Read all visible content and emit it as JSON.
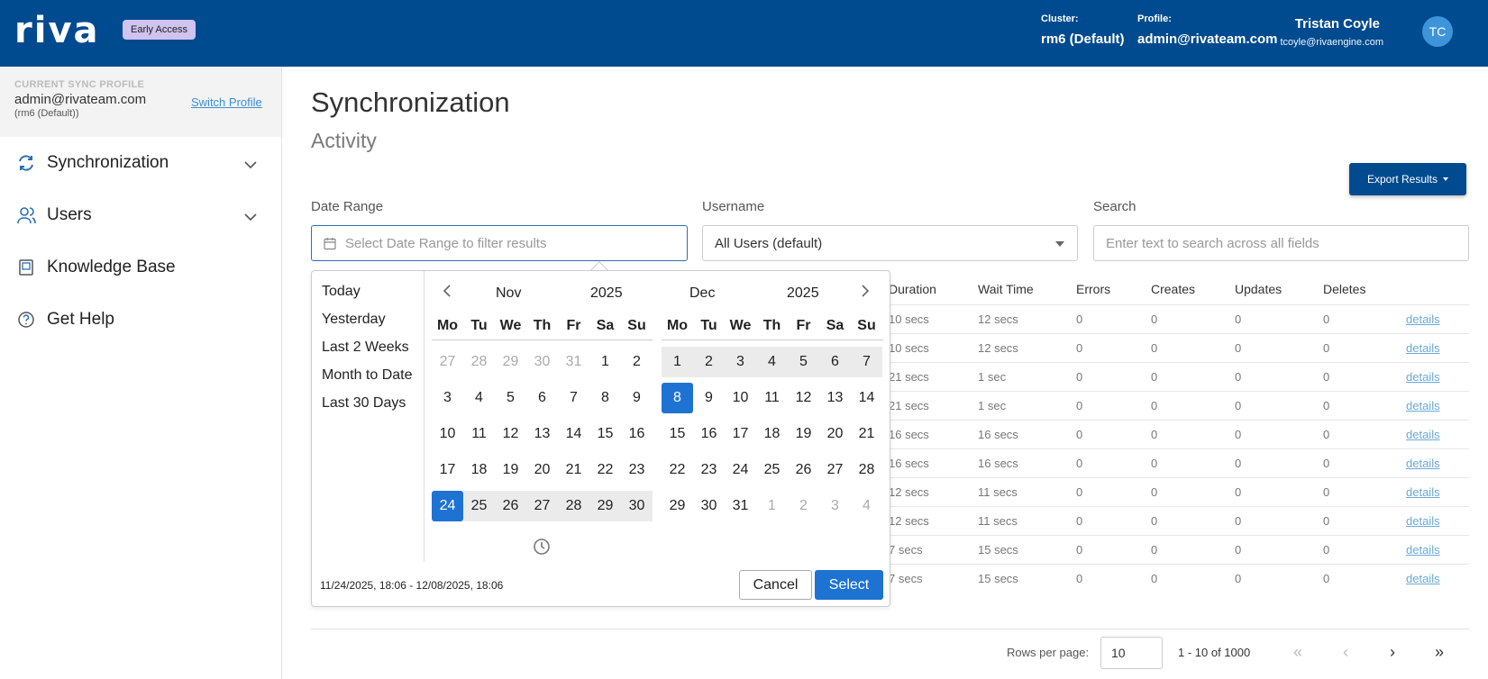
{
  "header": {
    "logo": "riva",
    "badge": "Early Access",
    "cluster_label": "Cluster:",
    "cluster_value": "rm6 (Default)",
    "profile_label": "Profile:",
    "profile_value": "admin@rivateam.com",
    "user_name": "Tristan Coyle",
    "user_email": "tcoyle@rivaengine.com",
    "avatar_initials": "TC"
  },
  "sidebar": {
    "profile_caption": "CURRENT SYNC PROFILE",
    "profile_email": "admin@rivateam.com",
    "profile_cluster": "(rm6 (Default))",
    "switch_label": "Switch Profile",
    "items": [
      {
        "label": "Synchronization",
        "icon": "sync-icon",
        "expandable": true
      },
      {
        "label": "Users",
        "icon": "users-icon",
        "expandable": true
      },
      {
        "label": "Knowledge Base",
        "icon": "book-icon",
        "expandable": false
      },
      {
        "label": "Get Help",
        "icon": "help-icon",
        "expandable": false
      }
    ]
  },
  "main": {
    "title": "Synchronization",
    "subtitle": "Activity",
    "export_label": "Export Results",
    "filters": {
      "date_label": "Date Range",
      "date_placeholder": "Select Date Range to filter results",
      "user_label": "Username",
      "user_value": "All Users (default)",
      "search_label": "Search",
      "search_placeholder": "Enter text to search across all fields"
    },
    "table": {
      "columns": [
        "Duration",
        "Wait Time",
        "Errors",
        "Creates",
        "Updates",
        "Deletes"
      ],
      "rows": [
        {
          "duration": "10 secs",
          "wait": "12 secs",
          "errors": "0",
          "creates": "0",
          "updates": "0",
          "deletes": "0",
          "link": "details"
        },
        {
          "duration": "10 secs",
          "wait": "12 secs",
          "errors": "0",
          "creates": "0",
          "updates": "0",
          "deletes": "0",
          "link": "details"
        },
        {
          "duration": "21 secs",
          "wait": "1 sec",
          "errors": "0",
          "creates": "0",
          "updates": "0",
          "deletes": "0",
          "link": "details"
        },
        {
          "duration": "21 secs",
          "wait": "1 sec",
          "errors": "0",
          "creates": "0",
          "updates": "0",
          "deletes": "0",
          "link": "details"
        },
        {
          "duration": "16 secs",
          "wait": "16 secs",
          "errors": "0",
          "creates": "0",
          "updates": "0",
          "deletes": "0",
          "link": "details"
        },
        {
          "duration": "16 secs",
          "wait": "16 secs",
          "errors": "0",
          "creates": "0",
          "updates": "0",
          "deletes": "0",
          "link": "details"
        },
        {
          "duration": "12 secs",
          "wait": "11 secs",
          "errors": "0",
          "creates": "0",
          "updates": "0",
          "deletes": "0",
          "link": "details"
        },
        {
          "duration": "12 secs",
          "wait": "11 secs",
          "errors": "0",
          "creates": "0",
          "updates": "0",
          "deletes": "0",
          "link": "details"
        },
        {
          "duration": "7 secs",
          "wait": "15 secs",
          "errors": "0",
          "creates": "0",
          "updates": "0",
          "deletes": "0",
          "link": "details"
        },
        {
          "duration": "7 secs",
          "wait": "15 secs",
          "errors": "0",
          "creates": "0",
          "updates": "0",
          "deletes": "0",
          "link": "details"
        }
      ]
    },
    "pager": {
      "rows_label": "Rows per page:",
      "rows_value": "10",
      "info": "1 - 10 of 1000",
      "first": "«",
      "prev": "‹",
      "next": "›",
      "last": "»"
    }
  },
  "datepicker": {
    "ranges": [
      "Today",
      "Yesterday",
      "Last 2 Weeks",
      "Month to Date",
      "Last 30 Days"
    ],
    "weekdays": [
      "Mo",
      "Tu",
      "We",
      "Th",
      "Fr",
      "Sa",
      "Su"
    ],
    "left": {
      "month": "Nov",
      "year": "2025",
      "weeks": [
        [
          {
            "d": "27",
            "off": true
          },
          {
            "d": "28",
            "off": true
          },
          {
            "d": "29",
            "off": true
          },
          {
            "d": "30",
            "off": true
          },
          {
            "d": "31",
            "off": true
          },
          {
            "d": "1"
          },
          {
            "d": "2"
          }
        ],
        [
          {
            "d": "3"
          },
          {
            "d": "4"
          },
          {
            "d": "5"
          },
          {
            "d": "6"
          },
          {
            "d": "7"
          },
          {
            "d": "8"
          },
          {
            "d": "9"
          }
        ],
        [
          {
            "d": "10"
          },
          {
            "d": "11"
          },
          {
            "d": "12"
          },
          {
            "d": "13"
          },
          {
            "d": "14"
          },
          {
            "d": "15"
          },
          {
            "d": "16"
          }
        ],
        [
          {
            "d": "17"
          },
          {
            "d": "18"
          },
          {
            "d": "19"
          },
          {
            "d": "20"
          },
          {
            "d": "21"
          },
          {
            "d": "22"
          },
          {
            "d": "23"
          }
        ],
        [
          {
            "d": "24",
            "active": true
          },
          {
            "d": "25",
            "range": true
          },
          {
            "d": "26",
            "range": true
          },
          {
            "d": "27",
            "range": true
          },
          {
            "d": "28",
            "range": true
          },
          {
            "d": "29",
            "range": true
          },
          {
            "d": "30",
            "range": true
          }
        ]
      ]
    },
    "right": {
      "month": "Dec",
      "year": "2025",
      "weeks": [
        [
          {
            "d": "1",
            "range": true
          },
          {
            "d": "2",
            "range": true
          },
          {
            "d": "3",
            "range": true
          },
          {
            "d": "4",
            "range": true
          },
          {
            "d": "5",
            "range": true
          },
          {
            "d": "6",
            "range": true
          },
          {
            "d": "7",
            "range": true
          }
        ],
        [
          {
            "d": "8",
            "active": true
          },
          {
            "d": "9"
          },
          {
            "d": "10"
          },
          {
            "d": "11"
          },
          {
            "d": "12"
          },
          {
            "d": "13"
          },
          {
            "d": "14"
          }
        ],
        [
          {
            "d": "15"
          },
          {
            "d": "16"
          },
          {
            "d": "17"
          },
          {
            "d": "18"
          },
          {
            "d": "19"
          },
          {
            "d": "20"
          },
          {
            "d": "21"
          }
        ],
        [
          {
            "d": "22"
          },
          {
            "d": "23"
          },
          {
            "d": "24"
          },
          {
            "d": "25"
          },
          {
            "d": "26"
          },
          {
            "d": "27"
          },
          {
            "d": "28"
          }
        ],
        [
          {
            "d": "29"
          },
          {
            "d": "30"
          },
          {
            "d": "31"
          },
          {
            "d": "1",
            "off": true
          },
          {
            "d": "2",
            "off": true
          },
          {
            "d": "3",
            "off": true
          },
          {
            "d": "4",
            "off": true
          }
        ]
      ]
    },
    "selection_text": "11/24/2025, 18:06 - 12/08/2025, 18:06",
    "cancel_label": "Cancel",
    "select_label": "Select",
    "colors": {
      "accent": "#1e73d2",
      "header": "#004a8f"
    }
  }
}
